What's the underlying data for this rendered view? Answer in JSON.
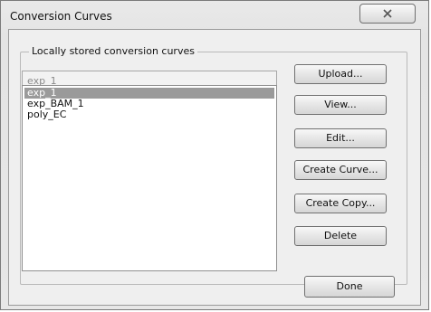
{
  "window": {
    "title": "Conversion Curves",
    "close_icon": "close-x-icon"
  },
  "group": {
    "label": "Locally stored conversion curves"
  },
  "entry": {
    "value": "exp_1"
  },
  "list": {
    "items": [
      "exp_1",
      "exp_BAM_1",
      "poly_EC"
    ],
    "selected": "exp_1"
  },
  "buttons": {
    "upload": "Upload...",
    "view": "View...",
    "edit": "Edit...",
    "create_curve": "Create Curve...",
    "create_copy": "Create Copy...",
    "delete": "Delete",
    "done": "Done"
  }
}
